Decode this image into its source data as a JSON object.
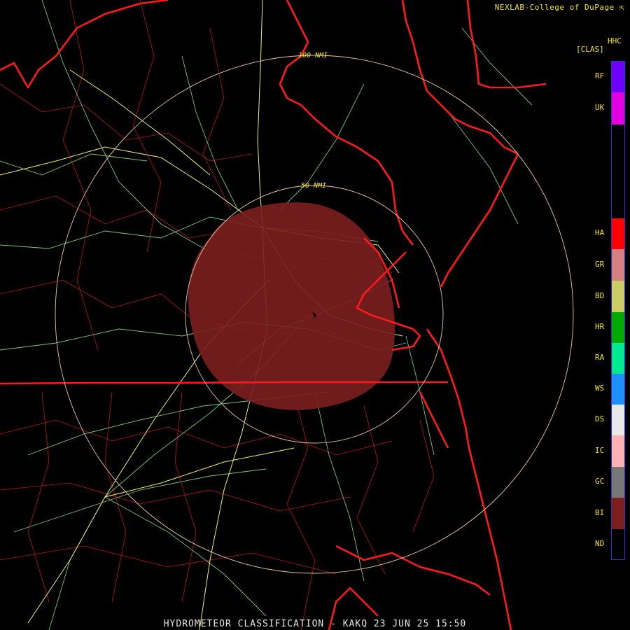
{
  "credit": "NEXLAB-College of DuPage",
  "footer": {
    "product": "HYDROMETEOR CLASSIFICATION",
    "separator": " - ",
    "station": "KAKQ",
    "datetime": "23 JUN 25 15:50"
  },
  "product_code": "HHC",
  "product_units": "[CLAS]",
  "rings": [
    {
      "label": "50 NMI",
      "range_nmi": 50
    },
    {
      "label": "100 NMI",
      "range_nmi": 100
    }
  ],
  "legend": [
    {
      "code": "RF",
      "color": "#6e00ff"
    },
    {
      "code": "UK",
      "color": "#e000e0"
    },
    {
      "code": "HA",
      "color": "#ff0000"
    },
    {
      "code": "GR",
      "color": "#d48080"
    },
    {
      "code": "BD",
      "color": "#cccc66"
    },
    {
      "code": "HR",
      "color": "#00aa00"
    },
    {
      "code": "RA",
      "color": "#00e890"
    },
    {
      "code": "WS",
      "color": "#1e90ff"
    },
    {
      "code": "DS",
      "color": "#e8e8e8"
    },
    {
      "code": "IC",
      "color": "#ffb0b0"
    },
    {
      "code": "GC",
      "color": "#777777"
    },
    {
      "code": "BI",
      "color": "#7a1e1e"
    },
    {
      "code": "ND",
      "color": "#000000"
    }
  ],
  "colors": {
    "state_border": "#ff1a1a",
    "county_border": "#cc1a1a",
    "highway": "#f0f070",
    "road": "#90e890",
    "ring": "#e8c8a0",
    "echo": "#7a1e1e"
  }
}
